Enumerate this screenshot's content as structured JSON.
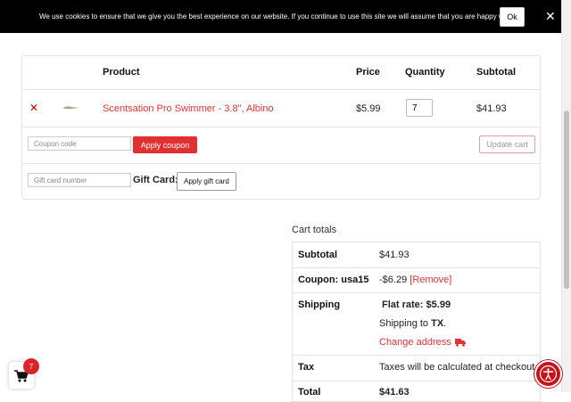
{
  "cookie": {
    "message": "We use cookies to ensure that we give you the best experience on our website. If you continue to use this site we will assume that you are happy with it.",
    "ok_label": "Ok",
    "close_icon": "close-icon"
  },
  "cart": {
    "headers": {
      "product": "Product",
      "price": "Price",
      "quantity": "Quantity",
      "subtotal": "Subtotal"
    },
    "items": [
      {
        "name": "Scentsation Pro Swimmer - 3.8\", Albino",
        "price": "$5.99",
        "quantity": "7",
        "subtotal": "$41.93"
      }
    ],
    "coupon_placeholder": "Coupon code",
    "apply_coupon_label": "Apply coupon",
    "update_cart_label": "Update cart",
    "gift_placeholder": "Gift card number",
    "gift_label": "Gift Card:",
    "apply_gift_label": "Apply gift card"
  },
  "totals": {
    "title": "Cart totals",
    "subtotal_label": "Subtotal",
    "subtotal_value": "$41.93",
    "coupon_label": "Coupon: usa15",
    "coupon_value": "-$6.29",
    "coupon_remove": "[Remove]",
    "shipping_label": "Shipping",
    "shipping_rate_label": "Flat rate:",
    "shipping_rate_value": "$5.99",
    "shipping_to_prefix": "Shipping to",
    "shipping_to_state": "TX",
    "shipping_to_suffix": ".",
    "change_address": "Change address",
    "tax_label": "Tax",
    "tax_value": "Taxes will be calculated at checkout",
    "total_label": "Total",
    "total_value": "$41.63"
  },
  "floating": {
    "cart_count": "7"
  },
  "colors": {
    "accent": "#e0302f",
    "link": "#d33333",
    "cookie_bar": "#000000"
  }
}
